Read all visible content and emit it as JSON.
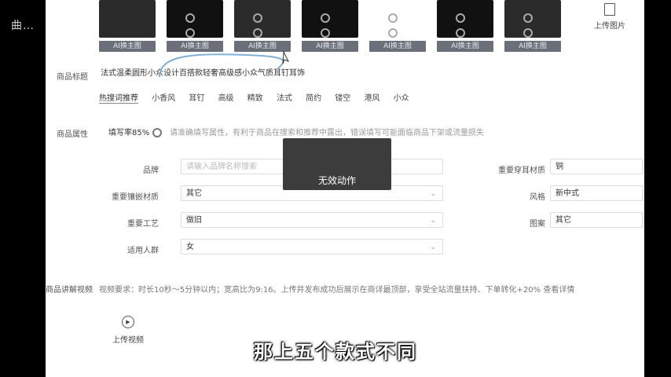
{
  "watermark": "曲…",
  "thumbnails": {
    "button_label": "AI换主图",
    "items": [
      {
        "style": "light",
        "label": "AI换主图"
      },
      {
        "style": "dark",
        "label": "AI换主图"
      },
      {
        "style": "light",
        "label": "AI换主图"
      },
      {
        "style": "dark",
        "label": "AI换主图"
      },
      {
        "style": "white",
        "label": "AI换主图"
      },
      {
        "style": "dark",
        "label": "AI换主图"
      },
      {
        "style": "light",
        "label": "AI换主图"
      }
    ],
    "upload_label": "上传图片"
  },
  "product_title": {
    "label": "商品标题",
    "value": "法式温柔圆形小众设计百搭款轻奢高级感小众气质耳钉耳饰"
  },
  "tags": {
    "hot": "热搜词推荐",
    "items": [
      "小香风",
      "耳钉",
      "高级",
      "精致",
      "法式",
      "简约",
      "镂空",
      "港风",
      "小众"
    ]
  },
  "attributes": {
    "label": "商品属性",
    "fill_rate": "填写率85%",
    "hint": "请准确填写属性，有利于商品在搜索和推荐中露出，错误填写可能面临商品下架或流量损失",
    "fields": [
      {
        "label": "品牌",
        "value": "请输入品牌名称搜索",
        "placeholder": true
      },
      {
        "label": "重要镶嵌材质",
        "value": "其它",
        "placeholder": false
      },
      {
        "label": "重要工艺",
        "value": "做旧",
        "placeholder": false
      },
      {
        "label": "适用人群",
        "value": "女",
        "placeholder": false
      }
    ],
    "right_fields": [
      {
        "label": "重要穿耳材质",
        "value": "铜"
      },
      {
        "label": "风格",
        "value": "新中式"
      },
      {
        "label": "图案",
        "value": "其它"
      }
    ]
  },
  "toast": "无效动作",
  "video": {
    "label": "商品讲解视频",
    "requirement": "视频要求：时长10秒～5分钟以内；宽高比为9:16。上传并发布成功后展示在商详最顶部，享受全站流量扶持、下单转化+20% 查看详情",
    "upload_label": "上传视频"
  },
  "subtitle": "那上五个款式不同"
}
